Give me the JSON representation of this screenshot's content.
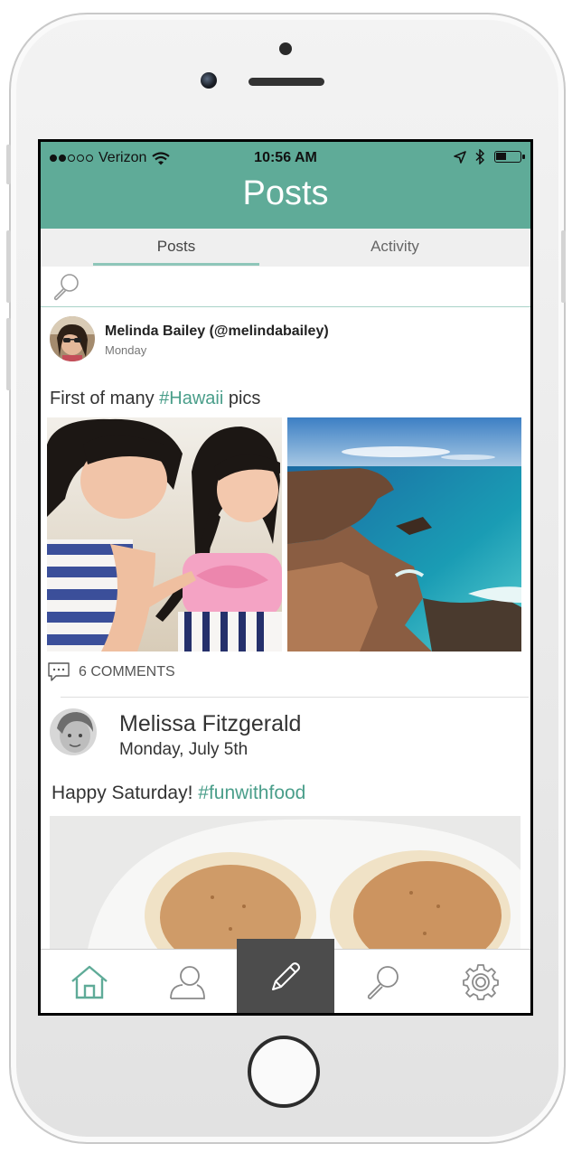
{
  "status_bar": {
    "carrier": "Verizon",
    "signal_bars": 2,
    "time": "10:56 AM"
  },
  "header": {
    "title": "Posts"
  },
  "tabs": [
    {
      "label": "Posts",
      "active": true
    },
    {
      "label": "Activity",
      "active": false
    }
  ],
  "search": {
    "icon": "search-icon"
  },
  "posts": [
    {
      "author": "Melinda Bailey (@melindabailey)",
      "date": "Monday",
      "caption_text": "First of many ",
      "caption_hashtag": "#Hawaii",
      "caption_suffix": " pics",
      "comments": "6 COMMENTS",
      "photos": [
        "girls-on-beach-photo",
        "hawaii-coastline-photo"
      ]
    },
    {
      "author": "Melissa Fitzgerald",
      "date": "Monday, July 5th",
      "caption_text": "Happy Saturday!  ",
      "caption_hashtag": "#funwithfood",
      "photos": [
        "pancakes-photo"
      ]
    }
  ],
  "bottom_tabs": [
    {
      "icon": "home-icon",
      "active": true
    },
    {
      "icon": "profile-icon",
      "active": false
    },
    {
      "icon": "pencil-icon",
      "active": false
    },
    {
      "icon": "search-icon",
      "active": false
    },
    {
      "icon": "gear-icon",
      "active": false
    }
  ],
  "colors": {
    "accent": "#5fab98",
    "hashtag": "#4a9e8a",
    "tab_underline": "#8ec6b9",
    "compose_bg": "#4c4c4c"
  }
}
